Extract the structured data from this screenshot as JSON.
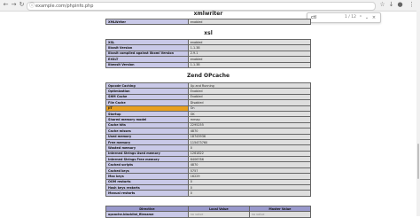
{
  "browser": {
    "url": "example.com/phpinfo.php",
    "find_query": "ctl",
    "find_count": "1 / 12"
  },
  "sections": {
    "xmlwriter": {
      "title": "xmlwriter",
      "rows": [
        [
          "XMLWriter",
          "enabled"
        ]
      ]
    },
    "xsl": {
      "title": "xsl",
      "rows": [
        [
          "XSL",
          "enabled"
        ],
        [
          "libxslt Version",
          "1.1.38"
        ],
        [
          "libxslt compiled against libxml Version",
          "2.9.1"
        ],
        [
          "EXSLT",
          "enabled"
        ],
        [
          "libexslt Version",
          "1.1.38"
        ]
      ]
    },
    "opcache": {
      "title": "Zend OPcache",
      "rows": [
        [
          "Opcode Caching",
          "Up and Running"
        ],
        [
          "Optimization",
          "Enabled"
        ],
        [
          "SHM Cache",
          "Enabled"
        ],
        [
          "File Cache",
          "Disabled"
        ],
        [
          "JIT",
          "On"
        ],
        [
          "Startup",
          "OK"
        ],
        [
          "Shared memory model",
          "mmap"
        ],
        [
          "Cache hits",
          "2295255"
        ],
        [
          "Cache misses",
          "4870"
        ],
        [
          "Used memory",
          "18743936"
        ],
        [
          "Free memory",
          "115473760"
        ],
        [
          "Wasted memory",
          "0"
        ],
        [
          "Interned Strings Used memory",
          "1261822"
        ],
        [
          "Interned Strings Free memory",
          "6406786"
        ],
        [
          "Cached scripts",
          "4870"
        ],
        [
          "Cached keys",
          "5757"
        ],
        [
          "Max keys",
          "16229"
        ],
        [
          "OOM restarts",
          "0"
        ],
        [
          "Hash keys restarts",
          "0"
        ],
        [
          "Manual restarts",
          "0"
        ]
      ],
      "directive_headers": [
        "Directive",
        "Local Value",
        "Master Value"
      ],
      "directive_rows": [
        [
          "opcache.blacklist_filename",
          "no value",
          "no value"
        ]
      ]
    }
  }
}
